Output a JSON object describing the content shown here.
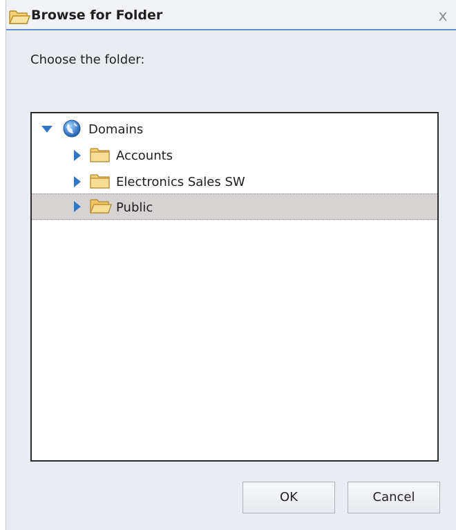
{
  "dialog": {
    "title": "Browse for Folder",
    "close_label": "x",
    "prompt": "Choose the folder:"
  },
  "tree": {
    "root": {
      "label": "Domains",
      "icon": "globe-icon",
      "expanded": true
    },
    "items": [
      {
        "label": "Accounts",
        "icon": "folder-icon",
        "selected": false
      },
      {
        "label": "Electronics Sales SW",
        "icon": "folder-icon",
        "selected": false
      },
      {
        "label": "Public",
        "icon": "folder-open-icon",
        "selected": true
      }
    ]
  },
  "buttons": {
    "ok": "OK",
    "cancel": "Cancel"
  }
}
